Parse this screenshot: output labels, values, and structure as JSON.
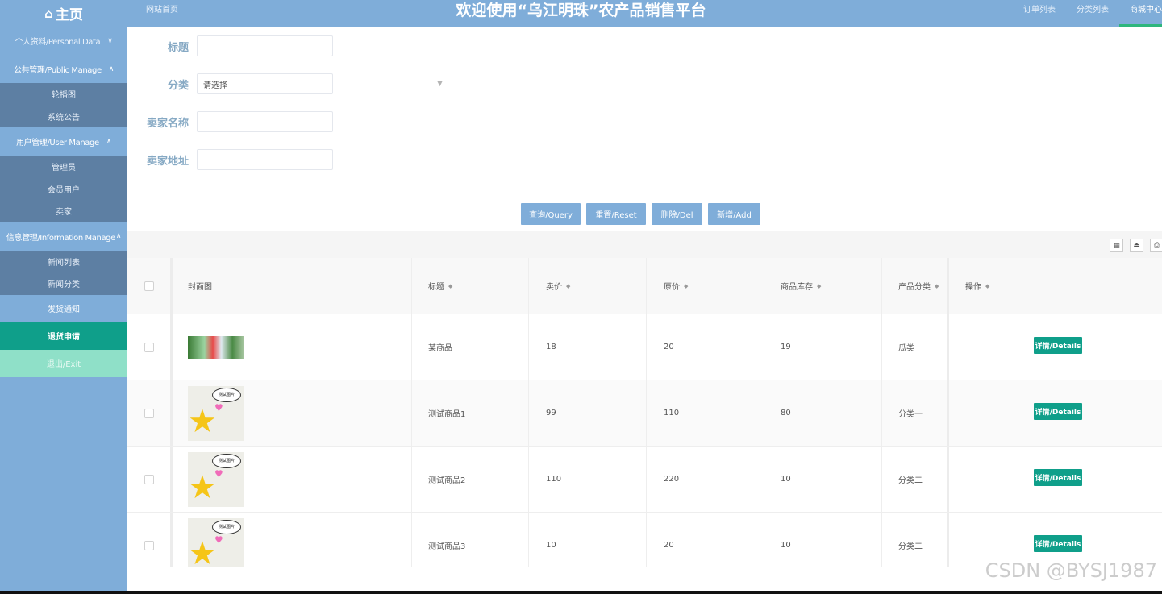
{
  "header": {
    "home_icon": "home-icon",
    "home_label": "主页",
    "site_home": "网站首页",
    "title": "欢迎使用“乌江明珠”农产品销售平台",
    "nav": [
      "订单列表",
      "分类列表",
      "商城中心"
    ]
  },
  "sidebar": {
    "personal": "个人资料/Personal Data",
    "public": "公共管理/Public Manage",
    "public_items": [
      "轮播图",
      "系统公告"
    ],
    "user": "用户管理/User Manage",
    "user_items": [
      "管理员",
      "会员用户",
      "卖家"
    ],
    "info": "信息管理/Information Manage",
    "info_items": [
      "新闻列表",
      "新闻分类"
    ],
    "shipping": "发货通知",
    "refund": "退货申请",
    "exit": "退出/Exit"
  },
  "form": {
    "title_label": "标题",
    "title_value": "",
    "category_label": "分类",
    "category_value": "请选择",
    "seller_name_label": "卖家名称",
    "seller_name_value": "",
    "seller_addr_label": "卖家地址",
    "seller_addr_value": ""
  },
  "buttons": {
    "query": "查询/Query",
    "reset": "重置/Reset",
    "delete": "删除/Del",
    "add": "新增/Add"
  },
  "table": {
    "headers": [
      "封面图",
      "标题",
      "卖价",
      "原价",
      "商品库存",
      "产品分类",
      "操作"
    ],
    "rows": [
      {
        "title": "某商品",
        "price": "18",
        "orig": "20",
        "stock": "19",
        "category": "瓜类",
        "action": "详情/Details",
        "bubble": ""
      },
      {
        "title": "测试商品1",
        "price": "99",
        "orig": "110",
        "stock": "80",
        "category": "分类一",
        "action": "详情/Details",
        "bubble": "测试图片"
      },
      {
        "title": "测试商品2",
        "price": "110",
        "orig": "220",
        "stock": "10",
        "category": "分类二",
        "action": "详情/Details",
        "bubble": "测试图片"
      },
      {
        "title": "测试商品3",
        "price": "10",
        "orig": "20",
        "stock": "10",
        "category": "分类二",
        "action": "详情/Details",
        "bubble": "测试图片"
      }
    ]
  },
  "toolbar_icons": [
    "columns-icon",
    "export-icon",
    "print-icon"
  ],
  "watermark": "CSDN @BYSJ1987"
}
